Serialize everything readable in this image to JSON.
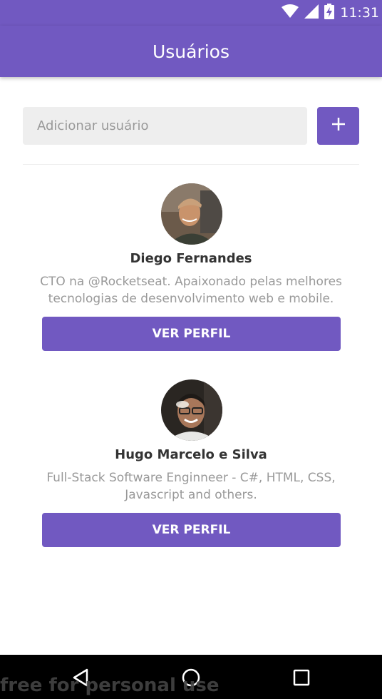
{
  "status_bar": {
    "time": "11:31",
    "icons": [
      "wifi-icon",
      "signal-icon",
      "battery-charging-icon"
    ]
  },
  "app_bar": {
    "title": "Usuários"
  },
  "form": {
    "placeholder": "Adicionar usuário",
    "value": "",
    "add_button_icon": "plus-icon"
  },
  "users": [
    {
      "name": "Diego Fernandes",
      "bio": "CTO na @Rocketseat. Apaixonado pelas melhores tecnologias de desenvolvimento web e mobile.",
      "button_label": "VER PERFIL"
    },
    {
      "name": "Hugo Marcelo e Silva",
      "bio": "Full-Stack Software Enginneer - C#, HTML, CSS, Javascript and others.",
      "button_label": "VER PERFIL"
    }
  ],
  "nav_bar": {
    "buttons": [
      "back-icon",
      "home-icon",
      "recents-icon"
    ]
  },
  "watermark": "free for personal use",
  "colors": {
    "primary": "#7159c1",
    "input_background": "#eeeeee",
    "name_text": "#333333",
    "bio_text": "#999999"
  }
}
